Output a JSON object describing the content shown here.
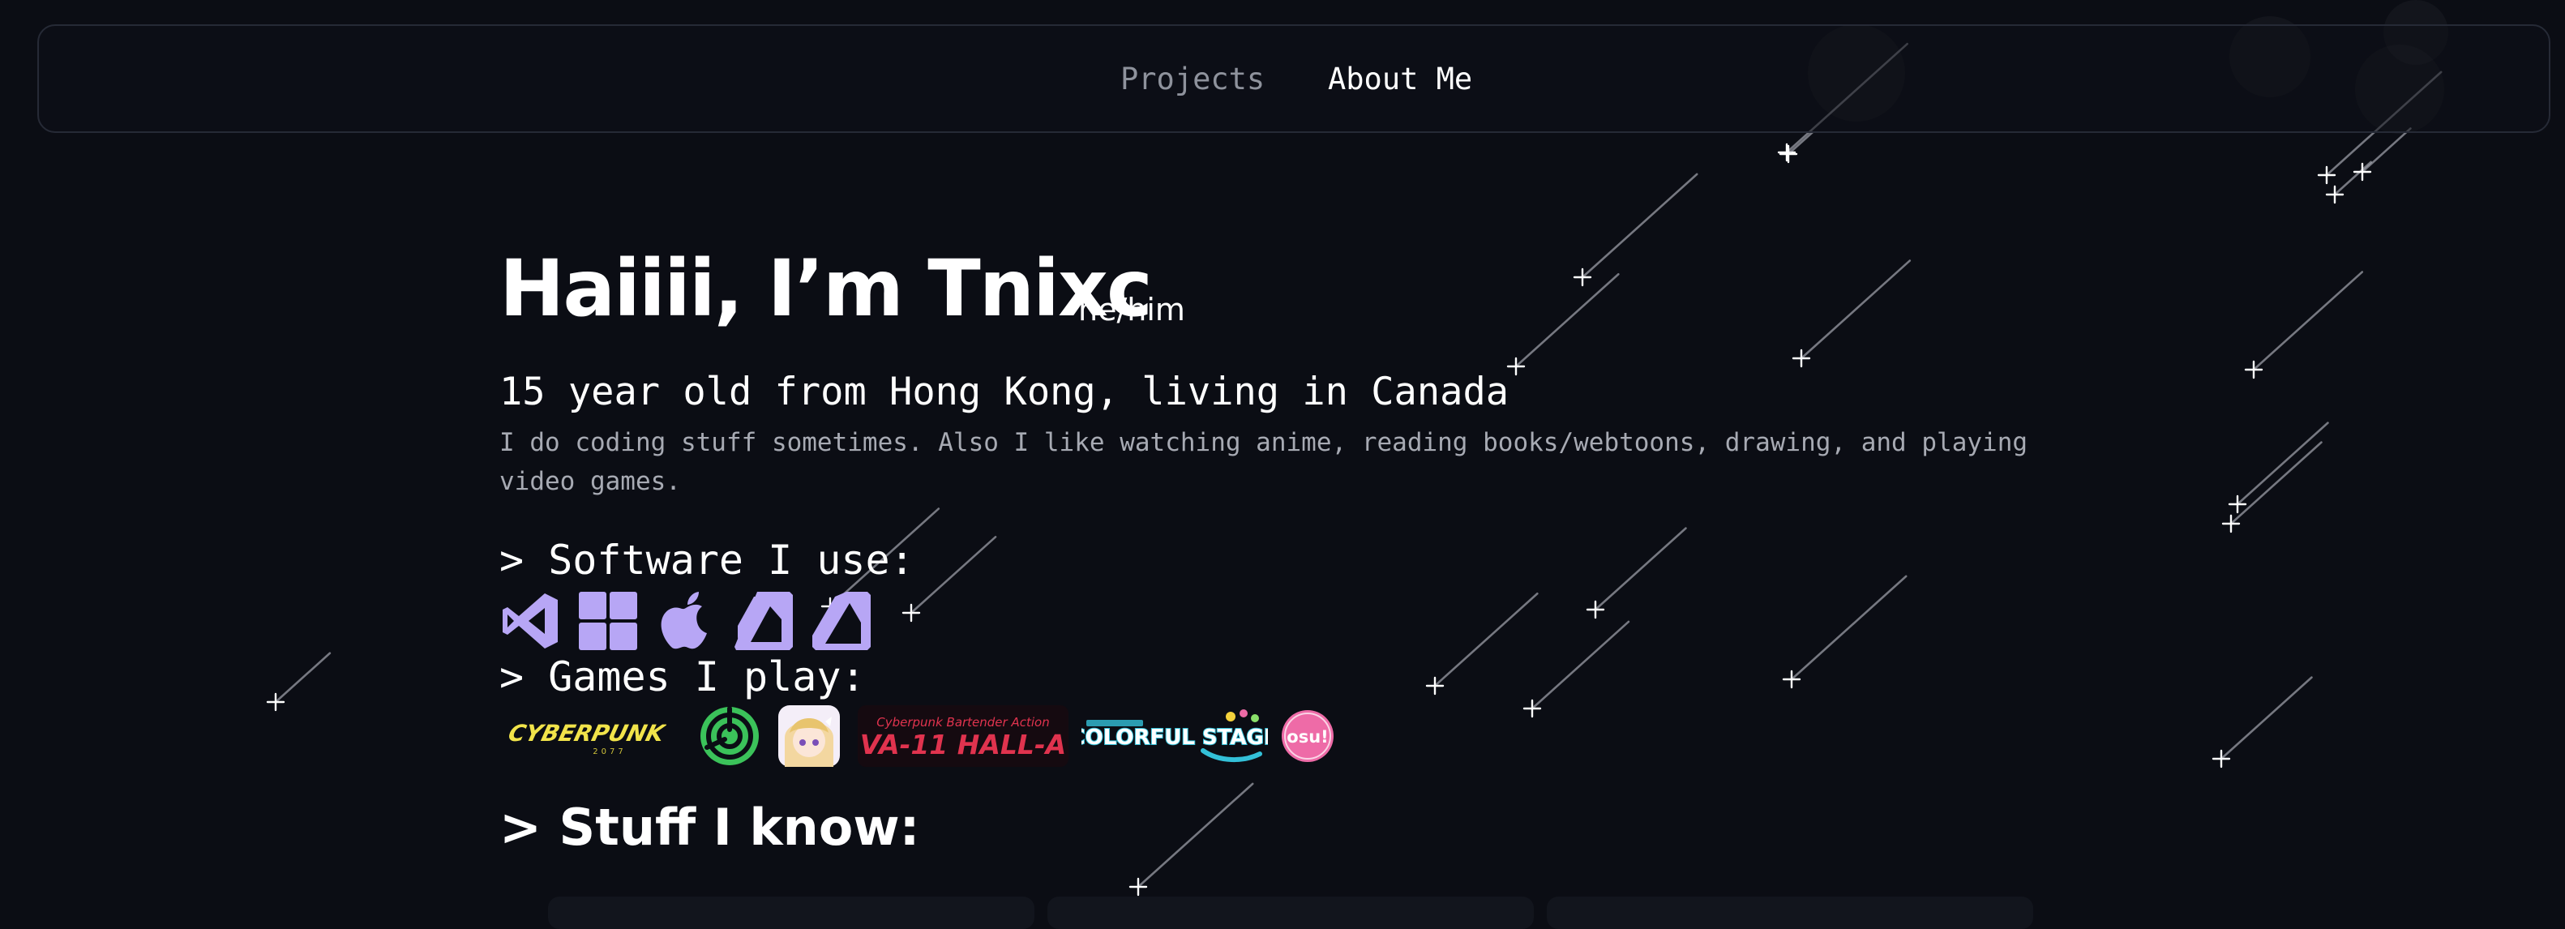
{
  "nav": {
    "projects_label": "Projects",
    "about_label": "About Me"
  },
  "hero": {
    "title": "Haiiii, I’m Tnixc",
    "pronouns": "he/him",
    "subtitle": "15 year old from Hong Kong, living in Canada",
    "bio": "I do coding stuff sometimes. Also I like watching anime, reading books/webtoons, drawing, and playing video games."
  },
  "software": {
    "heading": "> Software I use:",
    "icons": [
      "vscode-icon",
      "windows-icon",
      "apple-icon",
      "affinity-designer-icon",
      "affinity-photo-icon"
    ]
  },
  "games": {
    "heading": "> Games I play:",
    "items": [
      {
        "name": "Cyberpunk 2077",
        "logo_text": "CYBERPUNK",
        "logo_sub": "2077",
        "color": "#f1e34a"
      },
      {
        "name": "Xbox game icon",
        "color": "#3bc25a"
      },
      {
        "name": "Genshin Impact",
        "color": "#f0e6f7"
      },
      {
        "name": "VA-11 Hall-A",
        "logo_tagline": "Cyberpunk Bartender Action",
        "logo_text": "VA-11 HALL-A",
        "color": "#e0334e"
      },
      {
        "name": "Project Sekai Colorful Stage",
        "logo_text": "COLORFUL STAGE!",
        "color": "#33c0d8"
      },
      {
        "name": "osu!",
        "logo_text": "osu!",
        "color": "#ee6ba7"
      }
    ]
  },
  "stuff": {
    "heading": "> Stuff I know:"
  },
  "colors": {
    "background": "#0b0d14",
    "accent": "#b7a6f5",
    "muted": "#a7aab3",
    "nav_muted": "#8e929c"
  }
}
